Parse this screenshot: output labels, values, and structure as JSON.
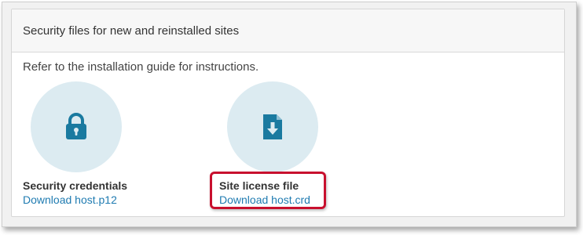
{
  "card": {
    "title": "Security files for new and reinstalled sites",
    "intro": "Refer to the installation guide for instructions."
  },
  "items": [
    {
      "title": "Security credentials",
      "link_label": "Download host.p12",
      "icon": "lock-icon"
    },
    {
      "title": "Site license file",
      "link_label": "Download host.crd",
      "icon": "file-download-icon"
    }
  ],
  "colors": {
    "icon": "#1a7aa0",
    "icon_circle": "#dcebf1",
    "link": "#1f7bb1",
    "highlight": "#c8102e"
  }
}
